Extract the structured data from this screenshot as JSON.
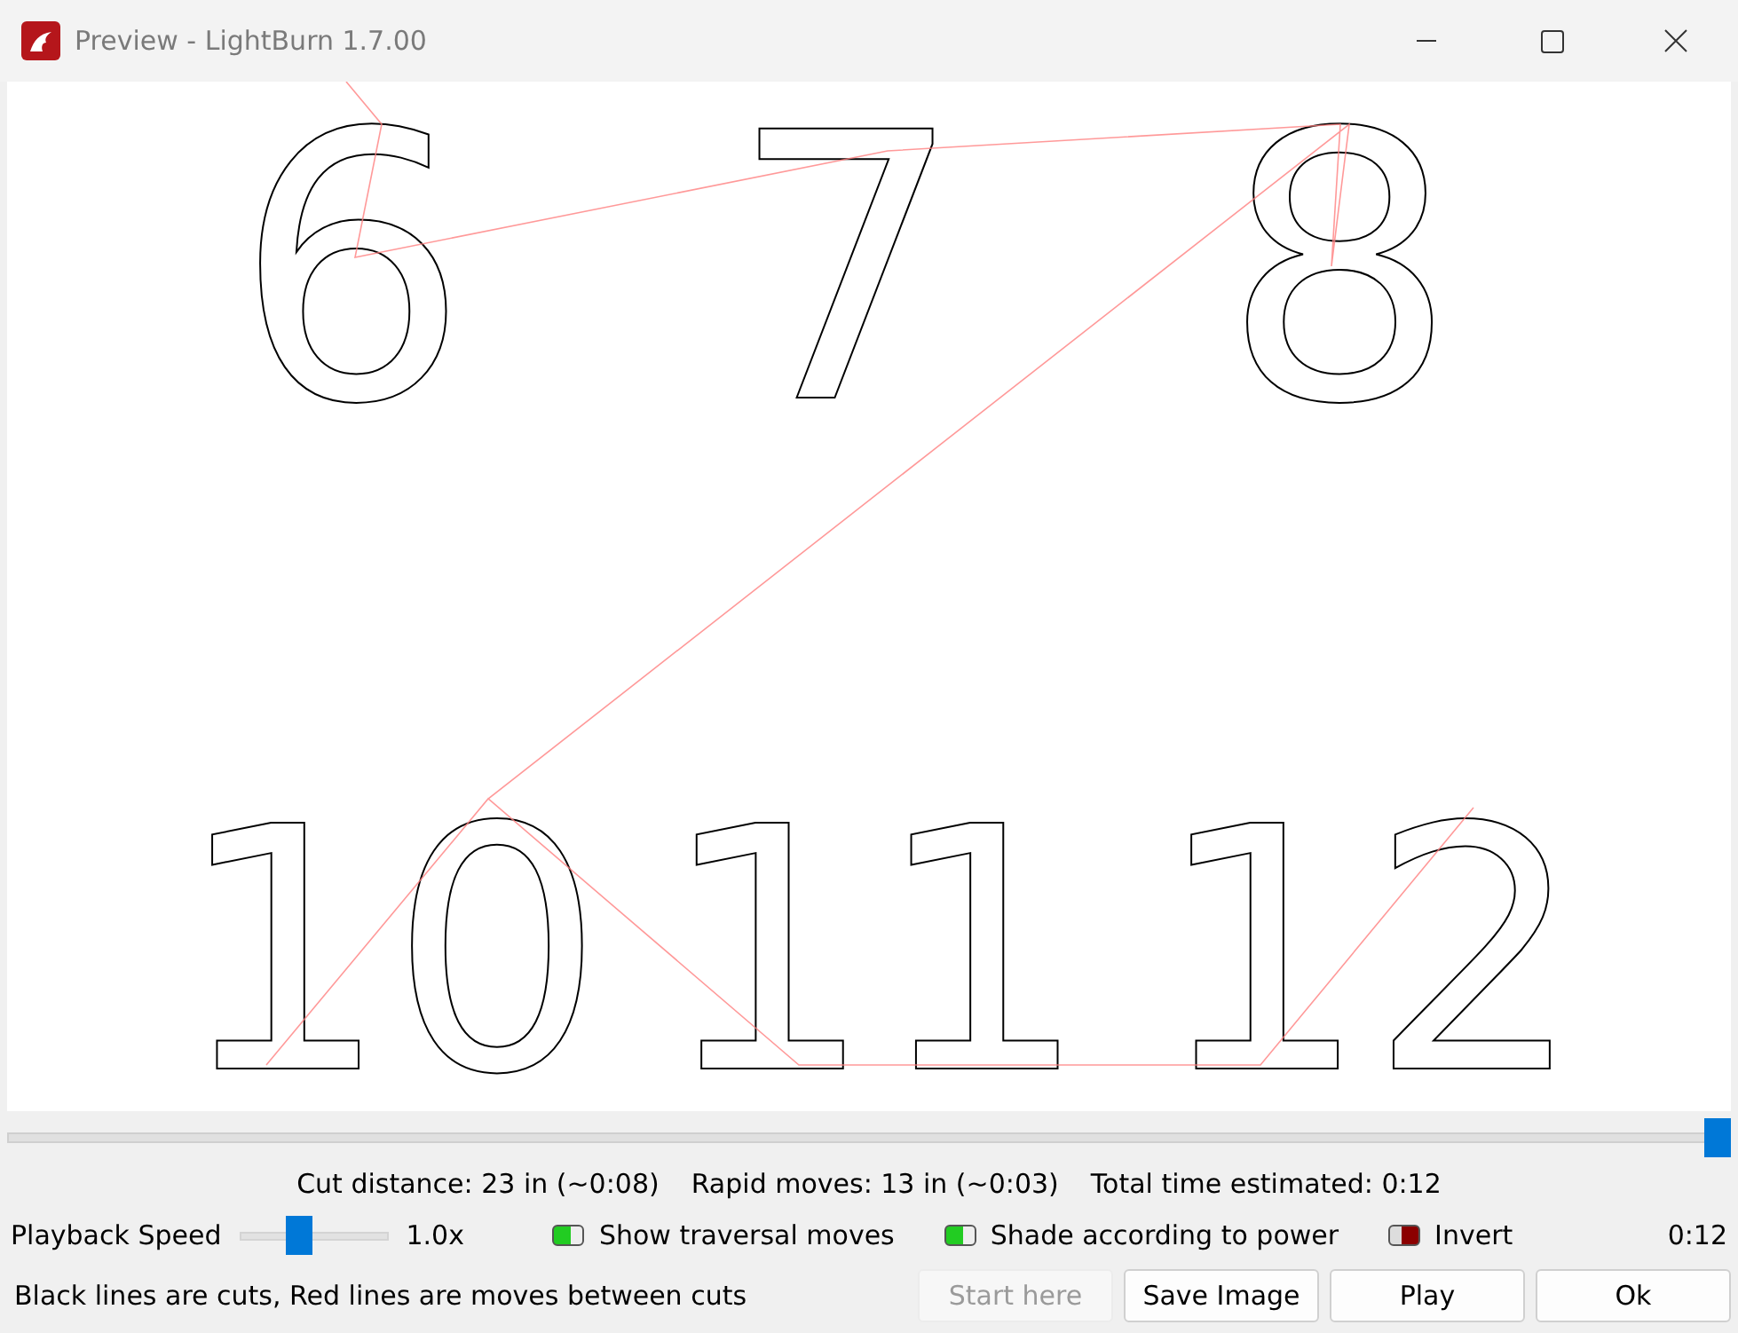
{
  "window": {
    "title": "Preview - LightBurn 1.7.00"
  },
  "canvas": {
    "top_row": [
      "6",
      "7",
      "8"
    ],
    "bottom_row": [
      "10",
      "11",
      "12"
    ]
  },
  "timeline": {
    "level": 1.0
  },
  "stats": {
    "cut_distance": "Cut distance: 23 in (~0:08)",
    "rapid_moves": "Rapid moves: 13 in (~0:03)",
    "total_time": "Total time estimated: 0:12"
  },
  "playback": {
    "label": "Playback Speed",
    "level": 0.4,
    "reading": "1.0x"
  },
  "toggles": [
    {
      "label": "Show traversal moves",
      "on": true
    },
    {
      "label": "Shade according to power",
      "on": true
    },
    {
      "label": "Invert",
      "on": false
    }
  ],
  "elapsed": "0:12",
  "legend": "Black lines are cuts, Red lines are moves between cuts",
  "buttons": [
    {
      "label": "Start here",
      "disabled": true
    },
    {
      "label": "Save Image",
      "disabled": false
    },
    {
      "label": "Play",
      "disabled": false
    },
    {
      "label": "Ok",
      "disabled": false
    }
  ]
}
